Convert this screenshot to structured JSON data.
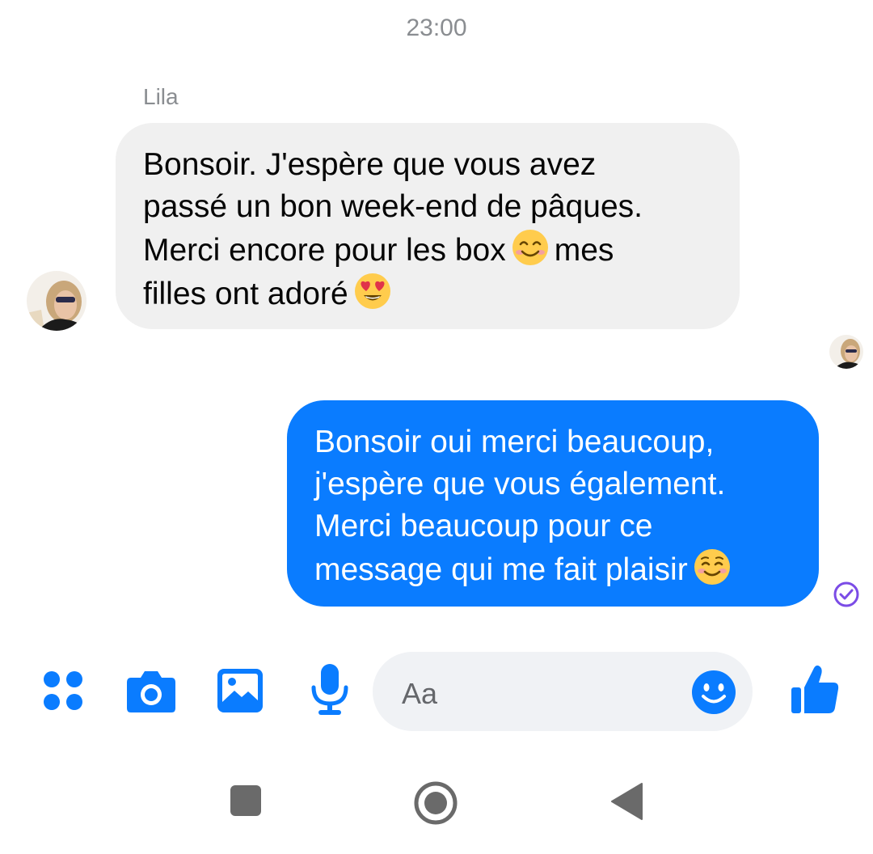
{
  "conversation": {
    "timestamp": "23:00",
    "sender_name": "Lila"
  },
  "messages": [
    {
      "direction": "incoming",
      "lines": [
        "Bonsoir. J'espère que vous avez",
        "passé un bon week-end de pâques.",
        "Merci encore pour les box",
        "mes",
        "filles ont adoré"
      ],
      "emojis": [
        "smiling-face-with-smiling-eyes",
        "smiling-face-with-heart-eyes"
      ]
    },
    {
      "direction": "outgoing",
      "lines": [
        "Bonsoir oui  merci beaucoup,",
        "j'espère que vous également.",
        "Merci beaucoup pour ce",
        "message qui me fait plaisir"
      ],
      "emojis": [
        "smiling-face"
      ],
      "status": "seen"
    }
  ],
  "composer": {
    "placeholder": "Aa",
    "icons": [
      "apps-icon",
      "camera-icon",
      "gallery-icon",
      "microphone-icon",
      "emoji-picker-icon",
      "like-icon"
    ]
  },
  "system_nav": {
    "icons": [
      "recents-icon",
      "home-icon",
      "back-icon"
    ]
  },
  "colors": {
    "accent": "#0a7cff",
    "incoming_bubble": "#f0f0f0",
    "outgoing_bubble": "#0a7cff",
    "seen_indicator": "#7b4ce6",
    "meta_text": "#8a8d91"
  }
}
